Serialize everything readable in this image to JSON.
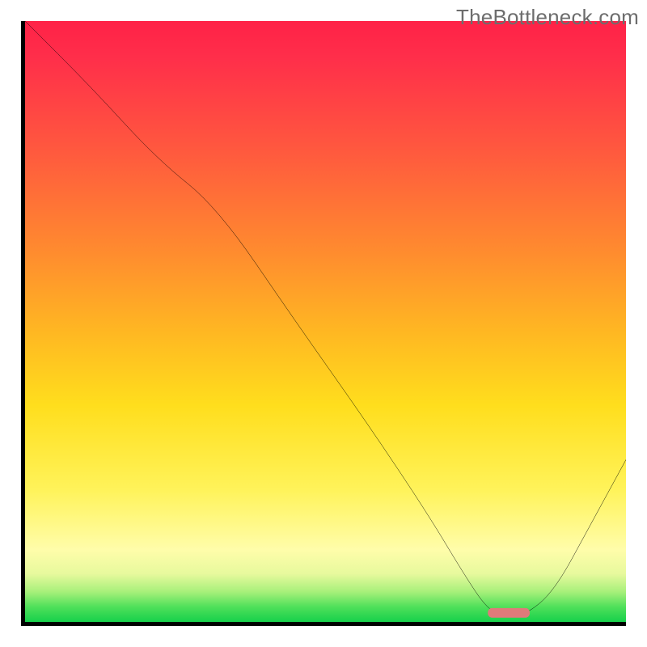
{
  "watermark": "TheBottleneck.com",
  "chart_data": {
    "type": "line",
    "title": "",
    "xlabel": "",
    "ylabel": "",
    "xlim": [
      0,
      100
    ],
    "ylim": [
      0,
      100
    ],
    "grid": false,
    "legend": false,
    "gradient_stops": [
      {
        "pos": 0,
        "color": "#ff2247"
      },
      {
        "pos": 6,
        "color": "#ff2e4a"
      },
      {
        "pos": 22,
        "color": "#ff5a3e"
      },
      {
        "pos": 38,
        "color": "#ff8a2f"
      },
      {
        "pos": 52,
        "color": "#ffb822"
      },
      {
        "pos": 64,
        "color": "#ffde1d"
      },
      {
        "pos": 78,
        "color": "#fff35a"
      },
      {
        "pos": 88,
        "color": "#fffdaa"
      },
      {
        "pos": 92,
        "color": "#e7f99d"
      },
      {
        "pos": 95,
        "color": "#a7f07a"
      },
      {
        "pos": 97.5,
        "color": "#4fe05a"
      },
      {
        "pos": 100,
        "color": "#16d04b"
      }
    ],
    "series": [
      {
        "name": "bottleneck-curve",
        "x": [
          0,
          11,
          22,
          32,
          45,
          57,
          67,
          73,
          77,
          80,
          83,
          88,
          94,
          100
        ],
        "y": [
          100,
          89,
          77,
          69,
          50,
          33,
          18,
          8,
          2,
          1,
          1,
          5,
          16,
          27
        ]
      }
    ],
    "marker": {
      "name": "optimal-range",
      "x_start": 77,
      "x_end": 84,
      "y": 1.5,
      "color": "#e07a7a"
    }
  }
}
